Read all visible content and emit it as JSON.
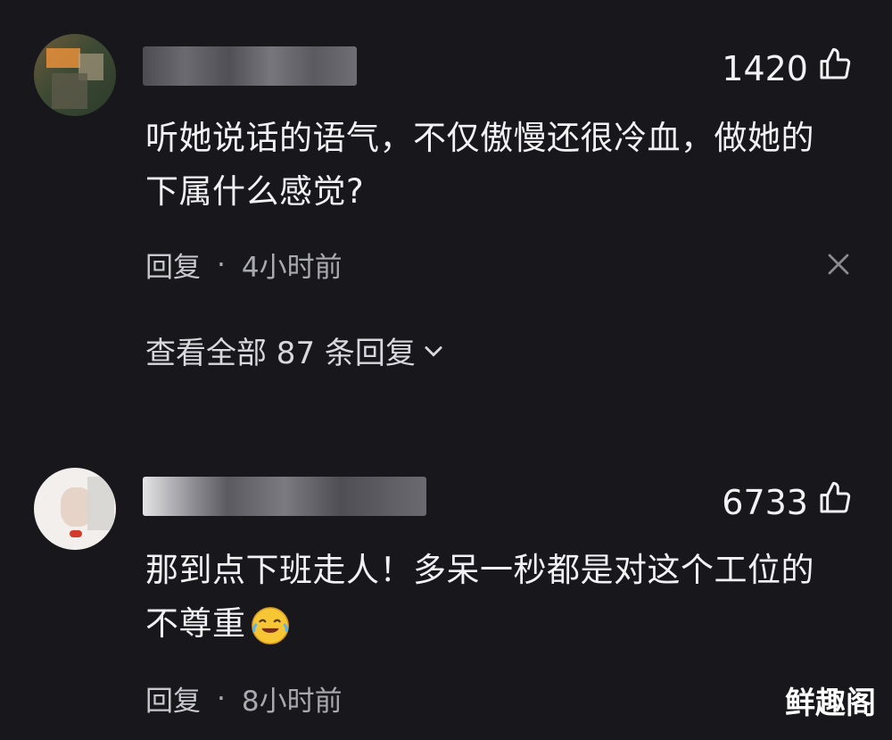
{
  "comments": [
    {
      "likes": "1420",
      "text_line1": "听她说话的语气，不仅傲慢还很冷血，做她的",
      "text_line2": "下属什么感觉?",
      "reply_label": "回复",
      "separator": "·",
      "time": "4小时前",
      "view_replies": "查看全部 87 条回复"
    },
    {
      "likes": "6733",
      "text_line1": "那到点下班走人！多呆一秒都是对这个工位的",
      "text_line2": "不尊重",
      "reply_label": "回复",
      "separator": "·",
      "time": "8小时前"
    }
  ],
  "watermark": "鲜趣阁",
  "icons": {
    "like": "thumbs-up-icon",
    "close": "close-icon",
    "expand": "chevron-down-icon",
    "emoji": "crying-laughing-emoji"
  }
}
